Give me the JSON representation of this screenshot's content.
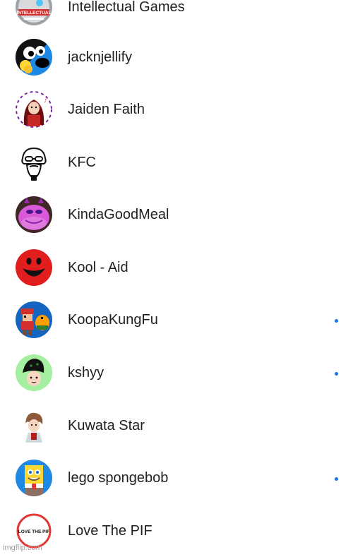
{
  "channels": [
    {
      "name": "Intellectual Games",
      "avatar_icon": "intellectual-games-logo-icon",
      "new_content": false
    },
    {
      "name": "jacknjellify",
      "avatar_icon": "jacknjellify-avatar-icon",
      "new_content": false
    },
    {
      "name": "Jaiden Faith",
      "avatar_icon": "jaiden-faith-avatar-icon",
      "new_content": false
    },
    {
      "name": "KFC",
      "avatar_icon": "kfc-colonel-icon",
      "new_content": false
    },
    {
      "name": "KindaGoodMeal",
      "avatar_icon": "kindagoodmeal-avatar-icon",
      "new_content": false
    },
    {
      "name": "Kool - Aid",
      "avatar_icon": "kool-aid-man-icon",
      "new_content": false
    },
    {
      "name": "KoopaKungFu",
      "avatar_icon": "koopakungfu-avatar-icon",
      "new_content": true
    },
    {
      "name": "kshyy",
      "avatar_icon": "kshyy-avatar-icon",
      "new_content": true
    },
    {
      "name": "Kuwata Star",
      "avatar_icon": "kuwata-star-avatar-icon",
      "new_content": false
    },
    {
      "name": "lego spongebob",
      "avatar_icon": "lego-spongebob-avatar-icon",
      "new_content": true
    },
    {
      "name": "Love The PIF",
      "avatar_icon": "love-the-pif-logo-icon",
      "new_content": false
    }
  ],
  "avatar_text": {
    "intellectual": "INTELLECTUAL",
    "pif": "LOVE THE PIF"
  },
  "watermark": "imgflip.com",
  "colors": {
    "text": "#202124",
    "new_content_dot": "#1a73e8",
    "pif_ring": "#e53935"
  }
}
